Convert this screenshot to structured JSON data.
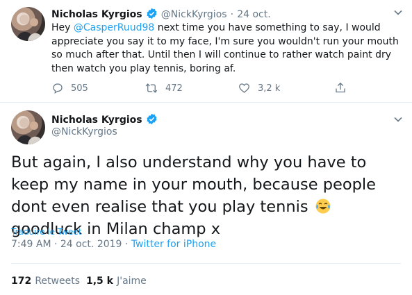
{
  "tweet1": {
    "display_name": "Nicholas Kyrgios",
    "handle": "@NickKyrgios",
    "separator": "·",
    "date": "24 oct.",
    "text_part1": "Hey ",
    "mention": "@CasperRuud98",
    "text_part2": " next time you have something to say, I would appreciate you say it to my face, I'm sure you wouldn't run your mouth so much after that. Until then I will continue to rather watch paint dry then watch you play tennis, boring af.",
    "replies": "505",
    "retweets": "472",
    "likes": "3,2 k"
  },
  "tweet2": {
    "display_name": "Nicholas Kyrgios",
    "handle": "@NickKyrgios",
    "text_part1": "But again, I also understand why you have to keep my name in your mouth, because people dont even realise that you play tennis",
    "text_part2": " goodluck in Milan champ x",
    "translate": "Traduire le Tweet",
    "time_date": "7:49 AM · 24 oct. 2019",
    "separator": "·",
    "source": "Twitter for iPhone",
    "retweet_count": "172",
    "retweet_label": "Retweets",
    "like_count": "1,5 k",
    "like_label": "J'aime"
  },
  "colors": {
    "accent": "#1da1f2",
    "muted": "#657786",
    "text": "#14171a",
    "divider": "#e6ecf0"
  },
  "icons": [
    "verified-badge-icon",
    "chevron-down-icon",
    "reply-icon",
    "retweet-icon",
    "like-icon",
    "share-icon",
    "tears-of-joy-emoji"
  ]
}
